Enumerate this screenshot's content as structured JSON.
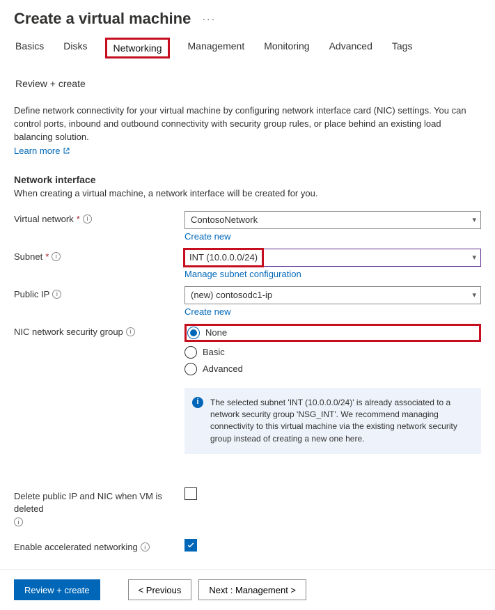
{
  "header": {
    "title": "Create a virtual machine"
  },
  "tabs": {
    "basics": "Basics",
    "disks": "Disks",
    "networking": "Networking",
    "management": "Management",
    "monitoring": "Monitoring",
    "advanced": "Advanced",
    "tags": "Tags",
    "review": "Review + create"
  },
  "intro": {
    "text": "Define network connectivity for your virtual machine by configuring network interface card (NIC) settings. You can control ports, inbound and outbound connectivity with security group rules, or place behind an existing load balancing solution.",
    "learn_more": "Learn more"
  },
  "section_netiface": {
    "title": "Network interface",
    "subtext": "When creating a virtual machine, a network interface will be created for you."
  },
  "fields": {
    "vnet_label": "Virtual network",
    "vnet_value": "ContosoNetwork",
    "vnet_create": "Create new",
    "subnet_label": "Subnet",
    "subnet_value": "INT (10.0.0.0/24)",
    "subnet_manage": "Manage subnet configuration",
    "pip_label": "Public IP",
    "pip_value": "(new) contosodc1-ip",
    "pip_create": "Create new",
    "nsg_label": "NIC network security group",
    "nsg_options": {
      "none": "None",
      "basic": "Basic",
      "advanced": "Advanced"
    },
    "delete_label": "Delete public IP and NIC when VM is deleted",
    "accel_label": "Enable accelerated networking"
  },
  "infobox": {
    "text": "The selected subnet 'INT (10.0.0.0/24)' is already associated to a network security group 'NSG_INT'. We recommend managing connectivity to this virtual machine via the existing network security group instead of creating a new one here."
  },
  "footer": {
    "review": "Review + create",
    "previous": "< Previous",
    "next": "Next : Management >"
  }
}
